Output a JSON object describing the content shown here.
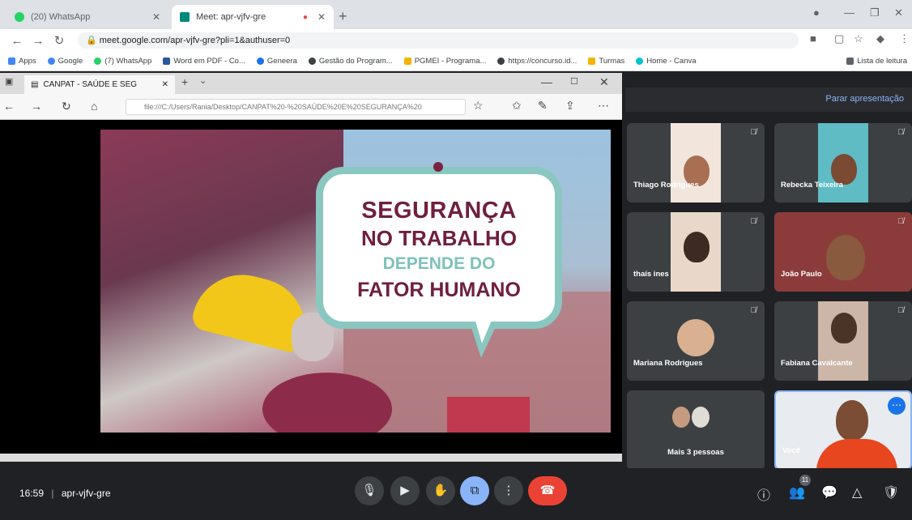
{
  "browser": {
    "tabs": [
      {
        "label": "(20) WhatsApp",
        "active": false,
        "favicon_color": "#25d366"
      },
      {
        "label": "Meet: apr-vjfv-gre",
        "active": true,
        "favicon_color": "#00897b"
      }
    ],
    "url": "meet.google.com/apr-vjfv-gre?pli=1&authuser=0",
    "bookmarks": [
      {
        "label": "Apps",
        "color": "#4285f4"
      },
      {
        "label": "Google",
        "color": "#4285f4"
      },
      {
        "label": "(7) WhatsApp",
        "color": "#25d366"
      },
      {
        "label": "Word em PDF - Co...",
        "color": "#2b579a"
      },
      {
        "label": "Geneera",
        "color": "#1a73e8"
      },
      {
        "label": "Gestão do Program...",
        "color": "#3c4043"
      },
      {
        "label": "PGMEI - Programa...",
        "color": "#f4b400"
      },
      {
        "label": "https://concurso.id...",
        "color": "#3c4043"
      },
      {
        "label": "Turmas",
        "color": "#f4b400"
      },
      {
        "label": "Home - Canva",
        "color": "#00c4cc"
      },
      {
        "label": "Lista de leitura",
        "color": "#5f6368"
      }
    ]
  },
  "edge": {
    "tab_label": "CANPAT - SAÚDE E SEG",
    "url": "file:///C:/Users/Rania/Desktop/CANPAT%20-%20SAÚDE%20E%20SEGURANÇA%20"
  },
  "slide": {
    "line1": "SEGURANÇA",
    "line2": "NO TRABALHO",
    "line3": "DEPENDE DO",
    "line4": "FATOR HUMANO",
    "colors": {
      "maroon": "#6f1f3f",
      "teal": "#7ec1bb",
      "helmet": "#f2c71a"
    }
  },
  "meet": {
    "stop_presenting": "Parar apresentação",
    "participants": [
      {
        "name": "Thiago Rodrigues"
      },
      {
        "name": "Rebecka Teixeira"
      },
      {
        "name": "thaís ines"
      },
      {
        "name": "João Paulo"
      },
      {
        "name": "Mariana Rodrigues"
      },
      {
        "name": "Fabiana Cavalcante"
      },
      {
        "name": "Mais 3 pessoas"
      },
      {
        "name": "Você"
      }
    ],
    "time": "16:59",
    "meeting_code": "apr-vjfv-gre",
    "participant_count": "11",
    "icons": [
      "mic-icon",
      "camera-icon",
      "raise-hand-icon",
      "present-icon",
      "more-options-icon",
      "end-call-icon",
      "info-icon",
      "people-icon",
      "chat-icon",
      "activities-icon",
      "host-controls-icon"
    ]
  }
}
